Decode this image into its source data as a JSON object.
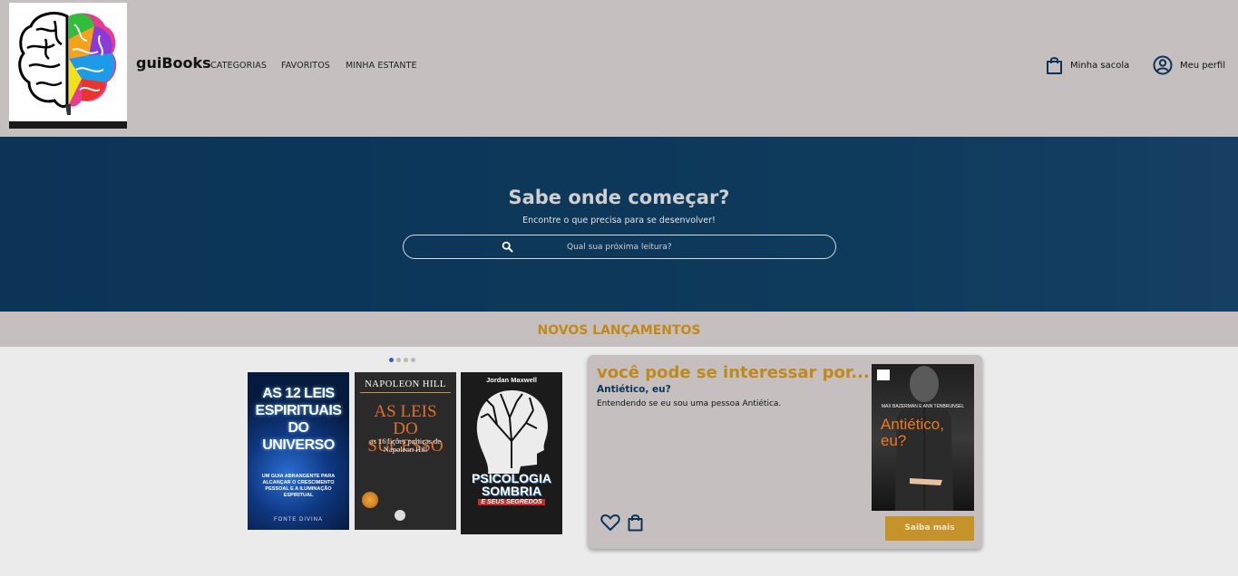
{
  "header": {
    "brand": "guiBooks",
    "nav": {
      "categories": "CATEGORIAS",
      "favorites": "FAVORITOS",
      "shelf": "MINHA ESTANTE"
    },
    "bag_label": "Minha sacola",
    "profile_label": "Meu perfil"
  },
  "hero": {
    "title": "Sabe onde começar?",
    "subtitle": "Encontre o que precisa para se desenvolver!",
    "search_placeholder": "Qual sua próxima leitura?"
  },
  "releases": {
    "title": "NOVOS LANÇAMENTOS",
    "active_dot": 1,
    "dot_count": 4,
    "books": [
      {
        "title": "AS 12 LEIS ESPIRITUAIS DO UNIVERSO",
        "subtitle": "UM GUIA ABRANGENTE PARA ALCANÇAR O CRESCIMENTO PESSOAL E A ILUMINAÇÃO ESPIRITUAL",
        "author": "FONTE DIVINA"
      },
      {
        "author": "NAPOLEON HILL",
        "title": "AS LEIS DO SUCESSO",
        "subtitle": "as 16 lições práticas de Napoleon Hill"
      },
      {
        "author": "Jordan Maxwell",
        "title": "PSICOLOGIA SOMBRIA",
        "subtitle": "E SEUS SEGREDOS"
      }
    ]
  },
  "suggestion": {
    "heading": "você pode se interessar por...",
    "book_title": "Antiético, eu?",
    "description": "Entendendo se eu sou uma pessoa Antiética.",
    "cover_title": "Antiético, eu?",
    "cover_authors": "MAX BAZERMAN E ANN TENBRUNSEL",
    "button_label": "Saiba mais"
  },
  "colors": {
    "header_bg": "#c5bfbf",
    "hero_bg": "#0b3457",
    "accent": "#c08a1b",
    "page_bg": "#ebebeb"
  }
}
